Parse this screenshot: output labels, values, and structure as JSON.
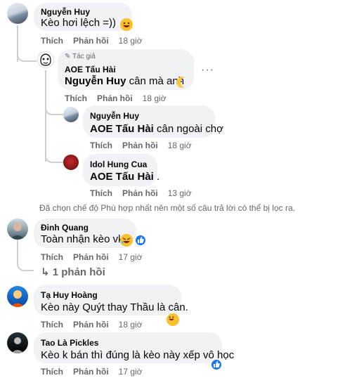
{
  "comments": [
    {
      "author": "Nguyễn Huy",
      "text": "Kèo hơi lệch =))",
      "emoji": "grinning-face",
      "actions": {
        "like": "Thích",
        "reply": "Phản hồi",
        "time": "18 giờ"
      },
      "replies": [
        {
          "badge": "Tác giả",
          "author": "AOE Tấu Hài",
          "tag": "Nguyễn Huy",
          "text": " cân mà anh",
          "emoji": "moon-face",
          "actions": {
            "like": "Thích",
            "reply": "Phản hồi",
            "time": "18 giờ"
          }
        },
        {
          "author": "Nguyễn Huy",
          "tag": "AOE Tấu Hài",
          "text": " cân ngoài chợ",
          "actions": {
            "like": "Thích",
            "reply": "Phản hồi",
            "time": "18 giờ"
          }
        },
        {
          "author": "Idol Hung Cua",
          "tag": "AOE Tấu Hài",
          "text": " .",
          "actions": {
            "like": "Thích",
            "reply": "Phản hồi",
            "time": "13 giờ"
          }
        }
      ]
    },
    {
      "author": "Đinh Quang",
      "text": "Toàn nhận kèo vkl",
      "emoji": "rofl-face",
      "reaction": "like",
      "actions": {
        "like": "Thích",
        "reply": "Phản hồi",
        "time": "17 giờ"
      },
      "reply_count": "1 phản hồi"
    },
    {
      "author": "Tạ Huy Hoàng",
      "text": "Kèo này Quýt thay Thầu là cân.",
      "reaction": "grinning-face",
      "actions": {
        "like": "Thích",
        "reply": "Phản hồi",
        "time": "18 giờ"
      }
    },
    {
      "author": "Tao Là Pickles",
      "text": "Kèo k bán thì đúng là kèo này xếp vô học",
      "reaction": "like",
      "actions": {
        "like": "Thích",
        "reply": "Phản hồi",
        "time": "17 giờ"
      }
    }
  ],
  "filter_note": "Đã chọn chế độ Phù hợp nhất nên một số câu trả lời có thể bị lọc ra.",
  "more_options": "···",
  "colors": {
    "bubble": "#f0f2f5",
    "meta": "#65676b",
    "like_blue": "#1877f2",
    "thread_line": "#ccd0d5"
  }
}
